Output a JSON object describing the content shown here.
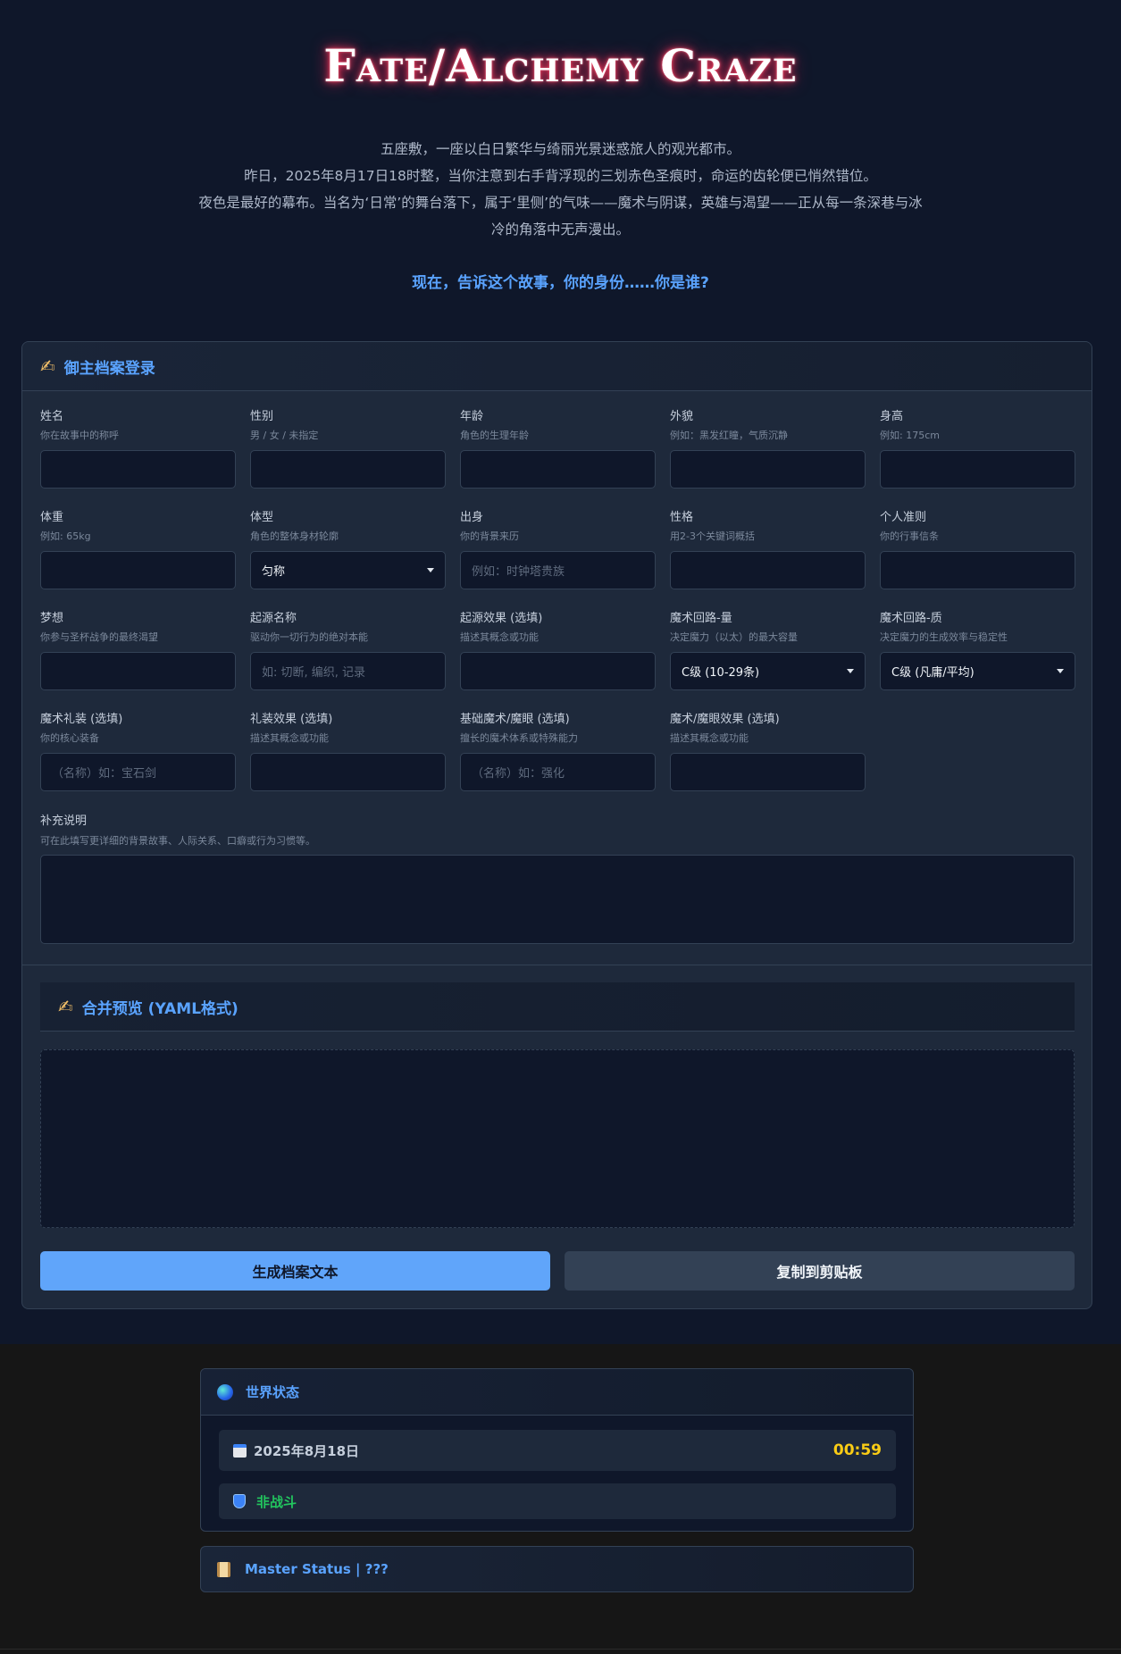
{
  "title": "Fate/Alchemy Craze",
  "intro": [
    "五座敷，一座以白日繁华与绮丽光景迷惑旅人的观光都市。",
    "昨日，2025年8月17日18时整，当你注意到右手背浮现的三划赤色圣痕时，命运的齿轮便已悄然错位。",
    "夜色是最好的幕布。当名为‘日常’的舞台落下，属于‘里侧’的气味——魔术与阴谋，英雄与渴望——正从每一条深巷与冰冷的角落中无声漫出。"
  ],
  "prompt": "现在，告诉这个故事，你的身份……你是谁?",
  "form": {
    "header": "御主档案登录",
    "fields": [
      {
        "label": "姓名",
        "hint": "你在故事中的称呼",
        "value": "",
        "kind": "input"
      },
      {
        "label": "性别",
        "hint": "男 / 女 / 未指定",
        "value": "",
        "kind": "input"
      },
      {
        "label": "年龄",
        "hint": "角色的生理年龄",
        "value": "",
        "kind": "input"
      },
      {
        "label": "外貌",
        "hint": "例如：黑发红瞳，气质沉静",
        "value": "",
        "kind": "input"
      },
      {
        "label": "身高",
        "hint": "例如: 175cm",
        "value": "",
        "kind": "input"
      },
      {
        "label": "体重",
        "hint": "例如: 65kg",
        "value": "",
        "kind": "input"
      },
      {
        "label": "体型",
        "hint": "角色的整体身材轮廓",
        "value": "匀称",
        "kind": "select"
      },
      {
        "label": "出身",
        "hint": "你的背景来历",
        "value": "例如：时钟塔贵族",
        "kind": "placeholder"
      },
      {
        "label": "性格",
        "hint": "用2-3个关键词概括",
        "value": "",
        "kind": "input"
      },
      {
        "label": "个人准则",
        "hint": "你的行事信条",
        "value": "",
        "kind": "input"
      },
      {
        "label": "梦想",
        "hint": "你参与圣杯战争的最终渴望",
        "value": "",
        "kind": "input"
      },
      {
        "label": "起源名称",
        "hint": "驱动你一切行为的绝对本能",
        "value": "如: 切断, 编织, 记录",
        "kind": "placeholder"
      },
      {
        "label": "起源效果 (选填)",
        "hint": "描述其概念或功能",
        "value": "",
        "kind": "input"
      },
      {
        "label": "魔术回路-量",
        "hint": "决定魔力（以太）的最大容量",
        "value": "C级 (10-29条)",
        "kind": "select"
      },
      {
        "label": "魔术回路-质",
        "hint": "决定魔力的生成效率与稳定性",
        "value": "C级 (凡庸/平均)",
        "kind": "select"
      },
      {
        "label": "魔术礼装 (选填)",
        "hint": "你的核心装备",
        "value": "（名称）如：宝石剑",
        "kind": "placeholder"
      },
      {
        "label": "礼装效果 (选填)",
        "hint": "描述其概念或功能",
        "value": "",
        "kind": "input"
      },
      {
        "label": "基础魔术/魔眼 (选填)",
        "hint": "擅长的魔术体系或特殊能力",
        "value": "（名称）如：强化",
        "kind": "placeholder"
      },
      {
        "label": "魔术/魔眼效果 (选填)",
        "hint": "描述其概念或功能",
        "value": "",
        "kind": "input"
      }
    ],
    "note_label": "补充说明",
    "note_hint": "可在此填写更详细的背景故事、人际关系、口癖或行为习惯等。",
    "preview_header": "合并预览 (YAML格式)",
    "generate_button": "生成档案文本",
    "copy_button": "复制到剪贴板"
  },
  "world": {
    "header": "世界状态",
    "date": "2025年8月18日",
    "time": "00:59",
    "status": "非战斗"
  },
  "master": {
    "header": "Master Status | ???"
  },
  "icons": {
    "form_header": "writing-hand-icon",
    "preview_header": "writing-hand-icon",
    "world": "globe-icon",
    "date": "calendar-icon",
    "status": "shield-icon",
    "master": "scroll-icon"
  },
  "colors": {
    "accent": "#5aa3ff",
    "primary_button": "#60a5fa",
    "time": "#facc15",
    "status": "#22c55e"
  }
}
